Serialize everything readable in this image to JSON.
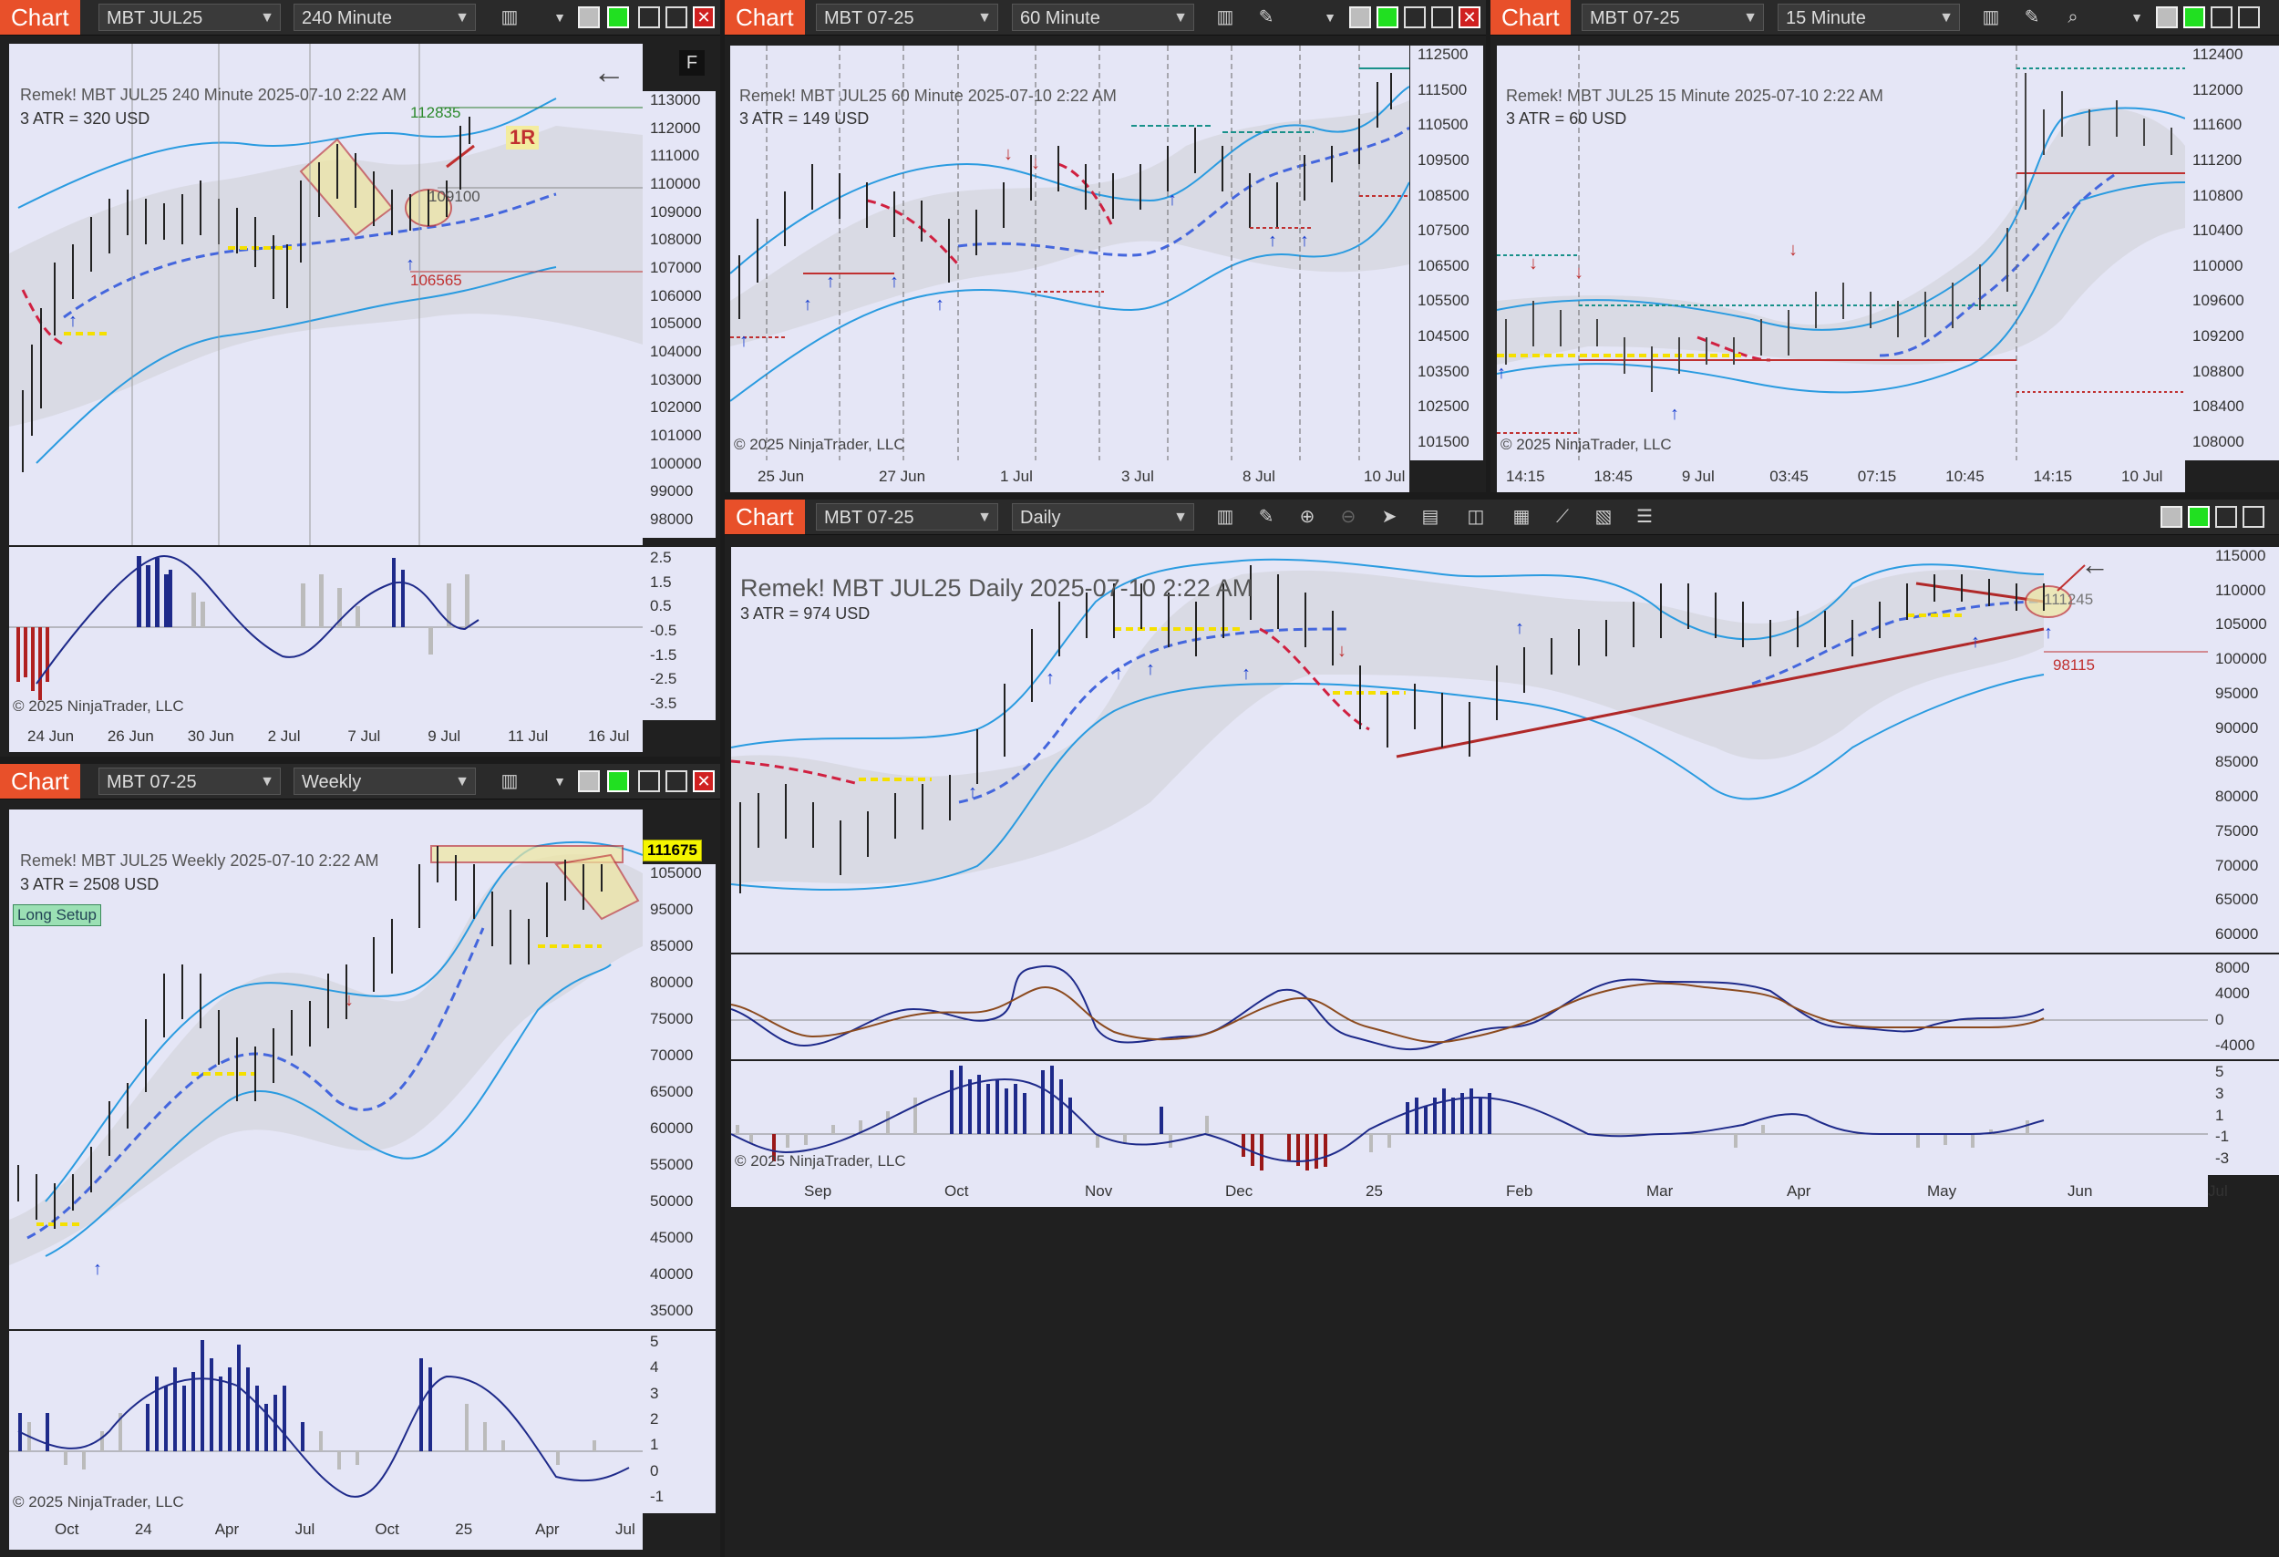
{
  "common": {
    "chart_tag": "Chart",
    "copyright": "© 2025 NinjaTrader, LLC",
    "last_price": "111675",
    "close_glyph": "✕"
  },
  "w1": {
    "instrument": "MBT JUL25",
    "interval": "240 Minute",
    "title": "Remek!  MBT JUL25  240 Minute  2025-07-10 2:22 AM",
    "atr": "3 ATR = 320 USD",
    "y_labels": [
      "113000",
      "112000",
      "111000",
      "110000",
      "109000",
      "108000",
      "107000",
      "106000",
      "105000",
      "104000",
      "103000",
      "102000",
      "101000",
      "100000",
      "99000",
      "98000"
    ],
    "osc_labels": [
      "2.5",
      "1.5",
      "0.5",
      "-0.5",
      "-1.5",
      "-2.5",
      "-3.5"
    ],
    "x_labels": [
      "24 Jun",
      "26 Jun",
      "30 Jun",
      "2 Jul",
      "7 Jul",
      "9 Jul",
      "11 Jul",
      "16 Jul"
    ],
    "annotations": {
      "target": "112835",
      "mid": "109100",
      "stop": "106565",
      "r_multiple": "1R",
      "f_badge": "F",
      "back_arrow": "←"
    }
  },
  "w2": {
    "instrument": "MBT 07-25",
    "interval": "60 Minute",
    "title": "Remek!  MBT JUL25  60 Minute  2025-07-10 2:22 AM",
    "atr": "3 ATR = 149 USD",
    "y_labels": [
      "112500",
      "111500",
      "110500",
      "109500",
      "108500",
      "107500",
      "106500",
      "105500",
      "104500",
      "103500",
      "102500",
      "101500"
    ],
    "x_labels": [
      "25 Jun",
      "27 Jun",
      "1 Jul",
      "3 Jul",
      "8 Jul",
      "10 Jul"
    ]
  },
  "w3": {
    "instrument": "MBT 07-25",
    "interval": "15 Minute",
    "title": "Remek!  MBT JUL25  15 Minute  2025-07-10 2:22 AM",
    "atr": "3 ATR = 60 USD",
    "y_labels": [
      "112400",
      "112000",
      "111600",
      "111200",
      "110800",
      "110400",
      "110000",
      "109600",
      "109200",
      "108800",
      "108400",
      "108000"
    ],
    "x_labels": [
      "14:15",
      "18:45",
      "9 Jul",
      "03:45",
      "07:15",
      "10:45",
      "14:15",
      "10 Jul"
    ]
  },
  "w4": {
    "instrument": "MBT 07-25",
    "interval": "Weekly",
    "title": "Remek!  MBT JUL25  Weekly  2025-07-10 2:22 AM",
    "atr": "3 ATR = 2508 USD",
    "setup": "Long Setup",
    "y_labels": [
      "105000",
      "95000",
      "85000",
      "80000",
      "75000",
      "70000",
      "65000",
      "60000",
      "55000",
      "50000",
      "45000",
      "40000",
      "35000"
    ],
    "osc_labels": [
      "5",
      "4",
      "3",
      "2",
      "1",
      "0",
      "-1"
    ],
    "x_labels": [
      "Oct",
      "24",
      "Apr",
      "Jul",
      "Oct",
      "25",
      "Apr",
      "Jul"
    ]
  },
  "w5": {
    "instrument": "MBT 07-25",
    "interval": "Daily",
    "title": "Remek!  MBT JUL25  Daily  2025-07-10 2:22 AM",
    "atr": "3 ATR = 974 USD",
    "y_labels": [
      "115000",
      "110000",
      "105000",
      "100000",
      "95000",
      "90000",
      "85000",
      "80000",
      "75000",
      "70000",
      "65000",
      "60000"
    ],
    "osc1_labels": [
      "8000",
      "4000",
      "0",
      "-4000"
    ],
    "osc2_labels": [
      "5",
      "3",
      "1",
      "-1",
      "-3"
    ],
    "x_labels": [
      "Sep",
      "Oct",
      "Nov",
      "Dec",
      "25",
      "Feb",
      "Mar",
      "Apr",
      "May",
      "Jun",
      "Jul"
    ],
    "annotations": {
      "level": "111245",
      "support": "98115"
    }
  }
}
